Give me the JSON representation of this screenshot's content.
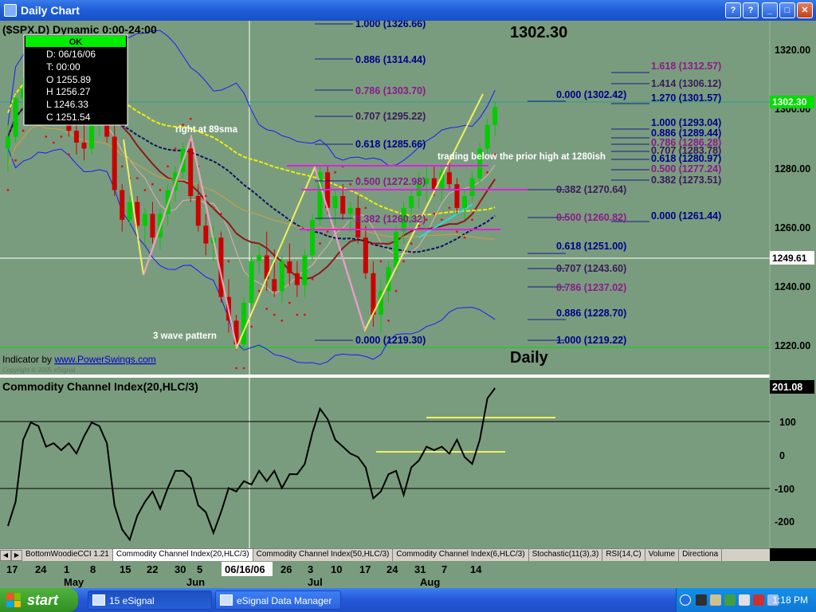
{
  "window": {
    "title": "Daily Chart",
    "buttons": {
      "help": "?",
      "minimize": "_",
      "maximize": "□",
      "close": "✕"
    }
  },
  "chart_header": {
    "symbol_text": "($SPX.D) Dynamic 0:00-24:00",
    "last_price": "1302.30",
    "panel_label": "Daily"
  },
  "data_window": {
    "ok": "OK",
    "date": "D: 06/16/06",
    "time": "T: 00:00",
    "open": "O 1255.89",
    "high": "H 1256.27",
    "low": "L 1246.33",
    "close": "C 1251.54"
  },
  "annotations": {
    "sma_note": "right at 89sma",
    "wave_note": "3 wave pattern",
    "prior_high_note": "trading below the prior high at 1280ish",
    "indicator_by_prefix": "Indicator by ",
    "indicator_link": "www.PowerSwings.com",
    "copyright": "Copyright © 2005 eSignal"
  },
  "price_axis": {
    "ticks": [
      "1320.00",
      "1300.00",
      "1280.00",
      "1260.00",
      "1240.00",
      "1220.00"
    ],
    "current_marker": "1302.30",
    "crosshair_marker": "1249.61"
  },
  "fib_levels": {
    "set_a": [
      "1.000 (1326.66)",
      "0.886 (1314.44)",
      "0.786 (1303.70)",
      "0.707 (1295.22)",
      "0.618 (1285.66)",
      "0.500 (1272.98)",
      "0.382 (1260.32)",
      "0.000 (1219.30)"
    ],
    "set_b": [
      "0.000 (1302.42)",
      "0.382 (1270.64)",
      "0.500 (1260.82)",
      "0.618 (1251.00)",
      "0.707 (1243.60)",
      "0.786 (1237.02)",
      "0.886 (1228.70)",
      "1.000 (1219.22)"
    ],
    "set_c": [
      "1.618 (1312.57)",
      "1.414 (1306.12)",
      "1.270 (1301.57)"
    ],
    "set_d": [
      "1.000 (1293.04)",
      "0.886 (1289.44)",
      "0.786 (1286.28)",
      "0.707 (1283.78)",
      "0.618 (1280.97)",
      "0.500 (1277.24)",
      "0.382 (1273.51)",
      "0.000 (1261.44)"
    ]
  },
  "cci_panel": {
    "title": "Commodity Channel Index(20,HLC/3)",
    "value": "201.08",
    "ticks": [
      "100",
      "0",
      "-100",
      "-200"
    ]
  },
  "tabs": [
    "BottomWoodieCCI 1.21",
    "Commodity Channel Index(20,HLC/3)",
    "Commodity Channel Index(50,HLC/3)",
    "Commodity Channel Index(6,HLC/3)",
    "Stochastic(11(3),3)",
    "RSI(14,C)",
    "Volume",
    "Directiona"
  ],
  "active_tab": 1,
  "date_axis": {
    "days": [
      "17",
      "24",
      "1",
      "8",
      "15",
      "22",
      "30",
      "5",
      "06/16/06",
      "26",
      "3",
      "10",
      "17",
      "24",
      "31",
      "7",
      "14"
    ],
    "months": [
      "May",
      "Jun",
      "Jul",
      "Aug"
    ]
  },
  "taskbar": {
    "start": "start",
    "tasks": [
      "15 eSignal",
      "eSignal Data Manager"
    ],
    "clock": "1:18 PM"
  },
  "colors": {
    "chart_bg": "#7a9c7e",
    "candle_up": "#00cc00",
    "candle_down": "#cc0000",
    "fib_magenta": "#8b1a8b",
    "fib_blue": "#00008b",
    "band_blue": "#1a1aff",
    "sma_yellow": "#f0f000"
  },
  "chart_data": {
    "type": "candlestick",
    "title": "",
    "symbol": "$SPX.D",
    "price_range": [
      1214,
      1330
    ],
    "cci_range": [
      -250,
      240
    ],
    "candles": [
      [
        1288,
        1296,
        1280,
        1292
      ],
      [
        1292,
        1306,
        1290,
        1305
      ],
      [
        1305,
        1312,
        1300,
        1308
      ],
      [
        1308,
        1318,
        1304,
        1314
      ],
      [
        1314,
        1320,
        1306,
        1310
      ],
      [
        1310,
        1314,
        1298,
        1300
      ],
      [
        1300,
        1308,
        1296,
        1304
      ],
      [
        1304,
        1310,
        1298,
        1302
      ],
      [
        1302,
        1306,
        1292,
        1294
      ],
      [
        1294,
        1300,
        1286,
        1290
      ],
      [
        1290,
        1296,
        1284,
        1288
      ],
      [
        1288,
        1298,
        1286,
        1296
      ],
      [
        1296,
        1304,
        1292,
        1300
      ],
      [
        1300,
        1304,
        1290,
        1292
      ],
      [
        1292,
        1296,
        1272,
        1274
      ],
      [
        1274,
        1276,
        1260,
        1264
      ],
      [
        1264,
        1272,
        1262,
        1270
      ],
      [
        1270,
        1272,
        1258,
        1262
      ],
      [
        1262,
        1268,
        1256,
        1266
      ],
      [
        1266,
        1270,
        1256,
        1258
      ],
      [
        1258,
        1268,
        1254,
        1266
      ],
      [
        1266,
        1276,
        1262,
        1274
      ],
      [
        1274,
        1282,
        1270,
        1280
      ],
      [
        1280,
        1290,
        1278,
        1288
      ],
      [
        1288,
        1292,
        1270,
        1272
      ],
      [
        1272,
        1276,
        1260,
        1262
      ],
      [
        1262,
        1266,
        1252,
        1256
      ],
      [
        1256,
        1262,
        1250,
        1258
      ],
      [
        1258,
        1260,
        1236,
        1238
      ],
      [
        1238,
        1244,
        1226,
        1230
      ],
      [
        1230,
        1232,
        1220,
        1222
      ],
      [
        1222,
        1238,
        1220,
        1236
      ],
      [
        1236,
        1252,
        1234,
        1250
      ],
      [
        1250,
        1256,
        1246,
        1252
      ],
      [
        1252,
        1260,
        1240,
        1244
      ],
      [
        1244,
        1254,
        1238,
        1240
      ],
      [
        1240,
        1252,
        1236,
        1250
      ],
      [
        1250,
        1256,
        1242,
        1246
      ],
      [
        1246,
        1250,
        1238,
        1242
      ],
      [
        1242,
        1254,
        1238,
        1252
      ],
      [
        1252,
        1266,
        1250,
        1264
      ],
      [
        1264,
        1282,
        1262,
        1280
      ],
      [
        1280,
        1282,
        1266,
        1268
      ],
      [
        1268,
        1274,
        1262,
        1272
      ],
      [
        1272,
        1276,
        1264,
        1266
      ],
      [
        1266,
        1270,
        1260,
        1268
      ],
      [
        1268,
        1272,
        1256,
        1258
      ],
      [
        1258,
        1262,
        1244,
        1246
      ],
      [
        1246,
        1250,
        1228,
        1232
      ],
      [
        1232,
        1244,
        1226,
        1240
      ],
      [
        1240,
        1250,
        1236,
        1248
      ],
      [
        1248,
        1262,
        1246,
        1260
      ],
      [
        1260,
        1270,
        1256,
        1268
      ],
      [
        1268,
        1274,
        1262,
        1272
      ],
      [
        1272,
        1280,
        1268,
        1276
      ],
      [
        1276,
        1282,
        1270,
        1278
      ],
      [
        1278,
        1282,
        1272,
        1274
      ],
      [
        1274,
        1282,
        1270,
        1280
      ],
      [
        1280,
        1284,
        1274,
        1276
      ],
      [
        1276,
        1278,
        1266,
        1268
      ],
      [
        1268,
        1274,
        1264,
        1272
      ],
      [
        1272,
        1280,
        1270,
        1278
      ],
      [
        1278,
        1290,
        1276,
        1288
      ],
      [
        1288,
        1298,
        1286,
        1296
      ],
      [
        1296,
        1304,
        1292,
        1302
      ]
    ],
    "cci": [
      -190,
      -120,
      60,
      110,
      100,
      40,
      50,
      30,
      50,
      20,
      70,
      110,
      100,
      50,
      -130,
      -200,
      -230,
      -160,
      -120,
      -90,
      -140,
      -80,
      -30,
      -30,
      -50,
      -130,
      -150,
      -210,
      -150,
      -80,
      -90,
      -60,
      -70,
      -30,
      -60,
      -30,
      -80,
      -40,
      -40,
      -10,
      80,
      150,
      120,
      60,
      40,
      20,
      10,
      -20,
      -110,
      -90,
      -40,
      -30,
      -100,
      -20,
      0,
      40,
      30,
      40,
      20,
      60,
      10,
      -10,
      60,
      180,
      210
    ]
  }
}
